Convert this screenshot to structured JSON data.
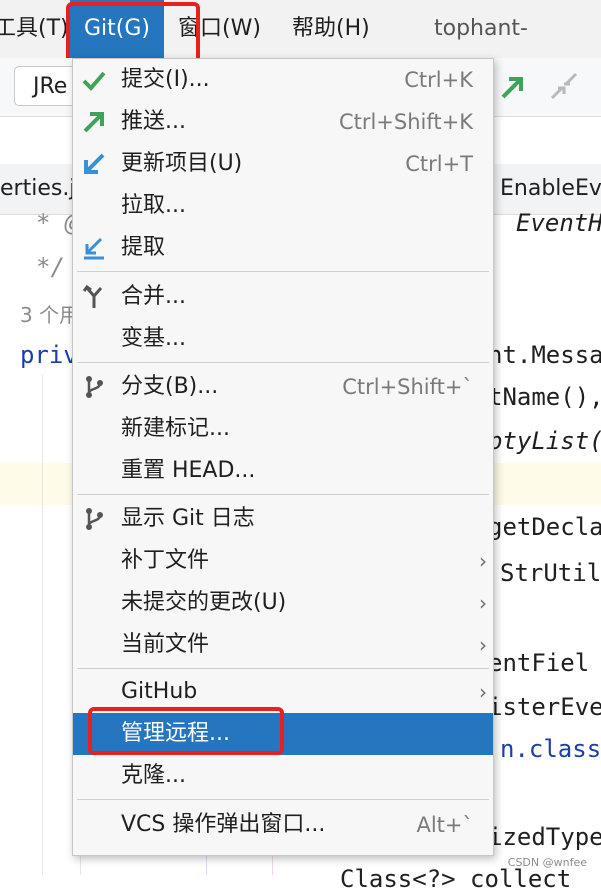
{
  "menubar": {
    "tools": "工具(T)",
    "git": "Git(G)",
    "window": "窗口(W)",
    "help": "帮助(H)",
    "project": "tophant-engine"
  },
  "toolbar": {
    "combo": "JRe"
  },
  "tabs": {
    "left": "erties.ja",
    "right": "EnableEv"
  },
  "editor": {
    "lines": {
      "l1": "* @",
      "l1r": "EventH",
      "l2": "*/",
      "l3": "3 个用",
      "l4": "priv",
      "l4r": "nt.Messa",
      "l5r": "tName(),",
      "l6r": "ptyList(",
      "l7r": "getDecla",
      "l8r": "StrUtil",
      "l9r": "entFiel",
      "l10r": "isterEve",
      "l11r": "n.class",
      "l12r": "izedType",
      "l13r": "Class<?> collect"
    }
  },
  "git_menu": {
    "items": [
      {
        "label": "提交(I)...",
        "shortcut": "Ctrl+K",
        "icon": "check-icon"
      },
      {
        "label": "推送...",
        "shortcut": "Ctrl+Shift+K",
        "icon": "push-arrow-icon"
      },
      {
        "label": "更新项目(U)",
        "shortcut": "Ctrl+T",
        "icon": "update-arrow-icon"
      },
      {
        "label": "拉取...",
        "shortcut": ""
      },
      {
        "label": "提取",
        "shortcut": "",
        "icon": "fetch-icon"
      },
      {
        "label": "合并...",
        "shortcut": "",
        "icon": "merge-icon"
      },
      {
        "label": "变基...",
        "shortcut": ""
      },
      {
        "label": "分支(B)...",
        "shortcut": "Ctrl+Shift+`",
        "icon": "branch-icon"
      },
      {
        "label": "新建标记...",
        "shortcut": ""
      },
      {
        "label": "重置 HEAD...",
        "shortcut": ""
      },
      {
        "label": "显示 Git 日志",
        "shortcut": "",
        "icon": "git-log-icon"
      },
      {
        "label": "补丁文件",
        "shortcut": ""
      },
      {
        "label": "未提交的更改(U)",
        "shortcut": ""
      },
      {
        "label": "当前文件",
        "shortcut": ""
      },
      {
        "label": "GitHub",
        "shortcut": ""
      },
      {
        "label": "管理远程...",
        "shortcut": ""
      },
      {
        "label": "克隆...",
        "shortcut": ""
      },
      {
        "label": "VCS 操作弹出窗口...",
        "shortcut": "Alt+`"
      }
    ]
  },
  "watermark": "CSDN @wnfee",
  "colors": {
    "accent": "#2675bf",
    "highlight_box": "#e8211f",
    "check_green": "#3fa35a",
    "blue_arrow": "#3b8fd6"
  }
}
